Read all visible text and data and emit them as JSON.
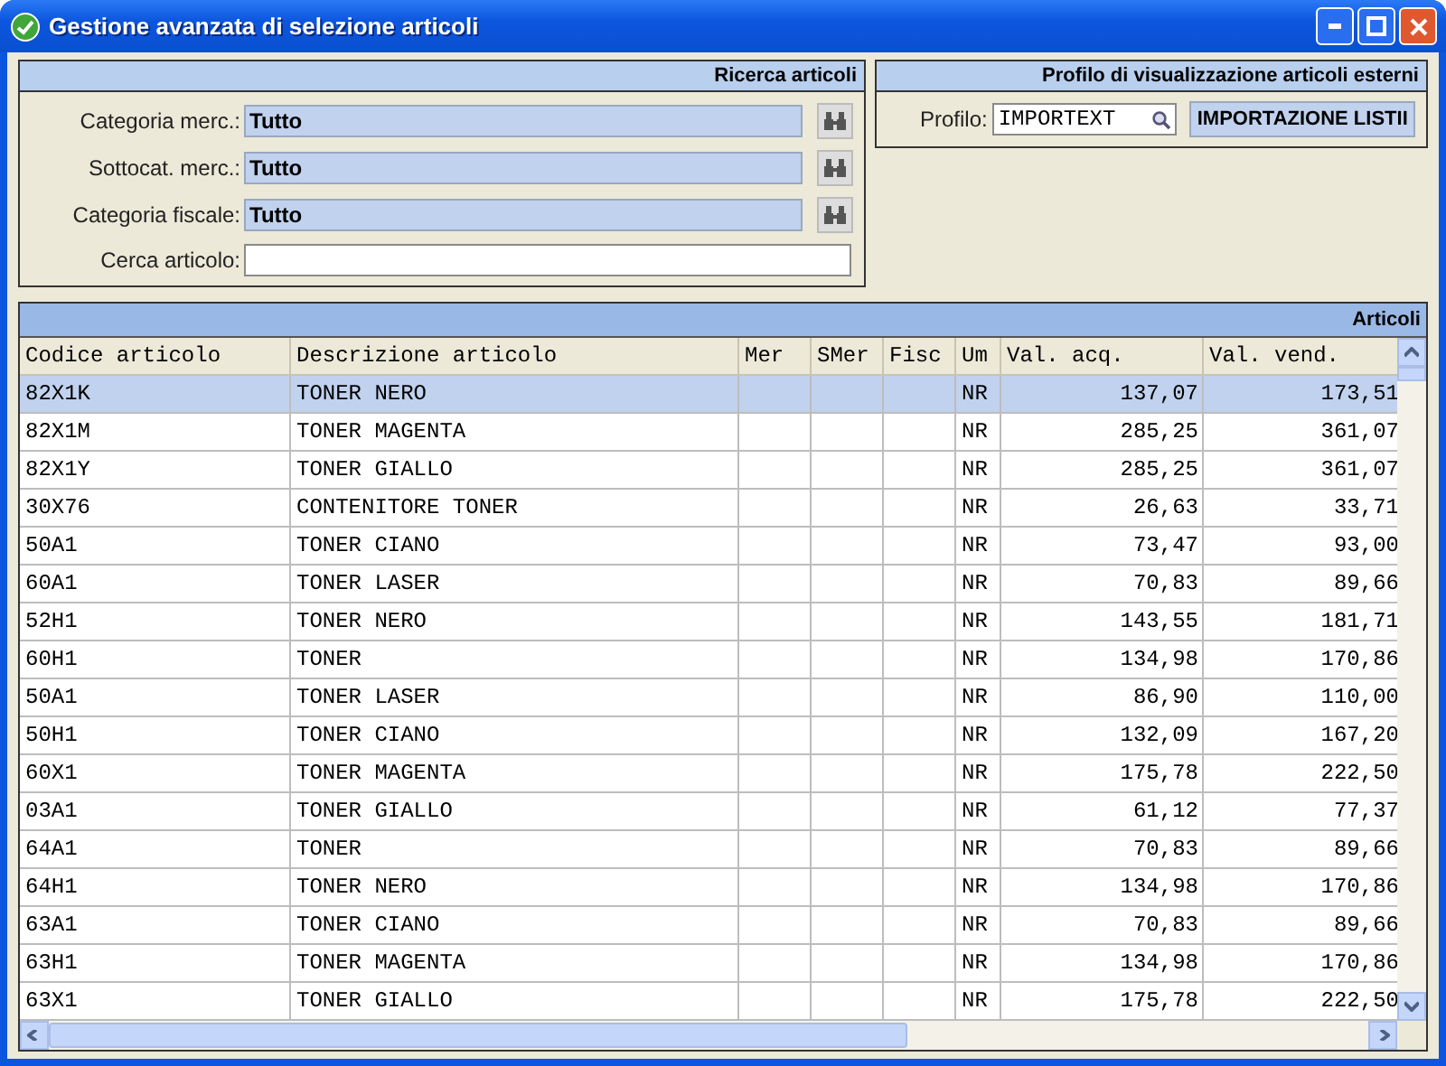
{
  "window": {
    "title": "Gestione avanzata di selezione articoli"
  },
  "search_panel": {
    "title": "Ricerca articoli",
    "fields": [
      {
        "kind": "lookup",
        "label": "Categoria merc.:",
        "value": "Tutto"
      },
      {
        "kind": "lookup",
        "label": "Sottocat. merc.:",
        "value": "Tutto"
      },
      {
        "kind": "lookup",
        "label": "Categoria fiscale:",
        "value": "Tutto"
      },
      {
        "kind": "text",
        "label": "Cerca articolo:"
      }
    ]
  },
  "profile_panel": {
    "title": "Profilo di visualizzazione articoli esterni",
    "label": "Profilo:",
    "value": "IMPORTEXT",
    "button": "IMPORTAZIONE LISTII"
  },
  "table": {
    "title": "Articoli",
    "columns": [
      "Codice articolo",
      "Descrizione articolo",
      "Mer",
      "SMer",
      "Fisc",
      "Um",
      "Val. acq.",
      "Val. vend."
    ],
    "rows": [
      {
        "code": "82X1K",
        "description": "TONER NERO",
        "unit": "NR",
        "purchase": "137,07",
        "sale": "173,51",
        "selected": true
      },
      {
        "code": "82X1M",
        "description": "TONER MAGENTA",
        "unit": "NR",
        "purchase": "285,25",
        "sale": "361,07",
        "selected": false
      },
      {
        "code": "82X1Y",
        "description": "TONER GIALLO",
        "unit": "NR",
        "purchase": "285,25",
        "sale": "361,07",
        "selected": false
      },
      {
        "code": "30X76",
        "description": "CONTENITORE TONER",
        "unit": "NR",
        "purchase": "26,63",
        "sale": "33,71",
        "selected": false
      },
      {
        "code": "50A1",
        "description": "TONER CIANO",
        "unit": "NR",
        "purchase": "73,47",
        "sale": "93,00",
        "selected": false
      },
      {
        "code": "60A1",
        "description": "TONER LASER",
        "unit": "NR",
        "purchase": "70,83",
        "sale": "89,66",
        "selected": false
      },
      {
        "code": "52H1",
        "description": "TONER NERO",
        "unit": "NR",
        "purchase": "143,55",
        "sale": "181,71",
        "selected": false
      },
      {
        "code": "60H1",
        "description": "TONER",
        "unit": "NR",
        "purchase": "134,98",
        "sale": "170,86",
        "selected": false
      },
      {
        "code": "50A1",
        "description": "TONER LASER",
        "unit": "NR",
        "purchase": "86,90",
        "sale": "110,00",
        "selected": false
      },
      {
        "code": "50H1",
        "description": "TONER CIANO",
        "unit": "NR",
        "purchase": "132,09",
        "sale": "167,20",
        "selected": false
      },
      {
        "code": "60X1",
        "description": "TONER MAGENTA",
        "unit": "NR",
        "purchase": "175,78",
        "sale": "222,50",
        "selected": false
      },
      {
        "code": "03A1",
        "description": "TONER GIALLO",
        "unit": "NR",
        "purchase": "61,12",
        "sale": "77,37",
        "selected": false
      },
      {
        "code": "64A1",
        "description": "TONER",
        "unit": "NR",
        "purchase": "70,83",
        "sale": "89,66",
        "selected": false
      },
      {
        "code": "64H1",
        "description": "TONER NERO",
        "unit": "NR",
        "purchase": "134,98",
        "sale": "170,86",
        "selected": false
      },
      {
        "code": "63A1",
        "description": "TONER CIANO",
        "unit": "NR",
        "purchase": "70,83",
        "sale": "89,66",
        "selected": false
      },
      {
        "code": "63H1",
        "description": "TONER MAGENTA",
        "unit": "NR",
        "purchase": "134,98",
        "sale": "170,86",
        "selected": false
      },
      {
        "code": "63X1",
        "description": "TONER GIALLO",
        "unit": "NR",
        "purchase": "175,78",
        "sale": "222,50",
        "selected": false
      }
    ]
  }
}
